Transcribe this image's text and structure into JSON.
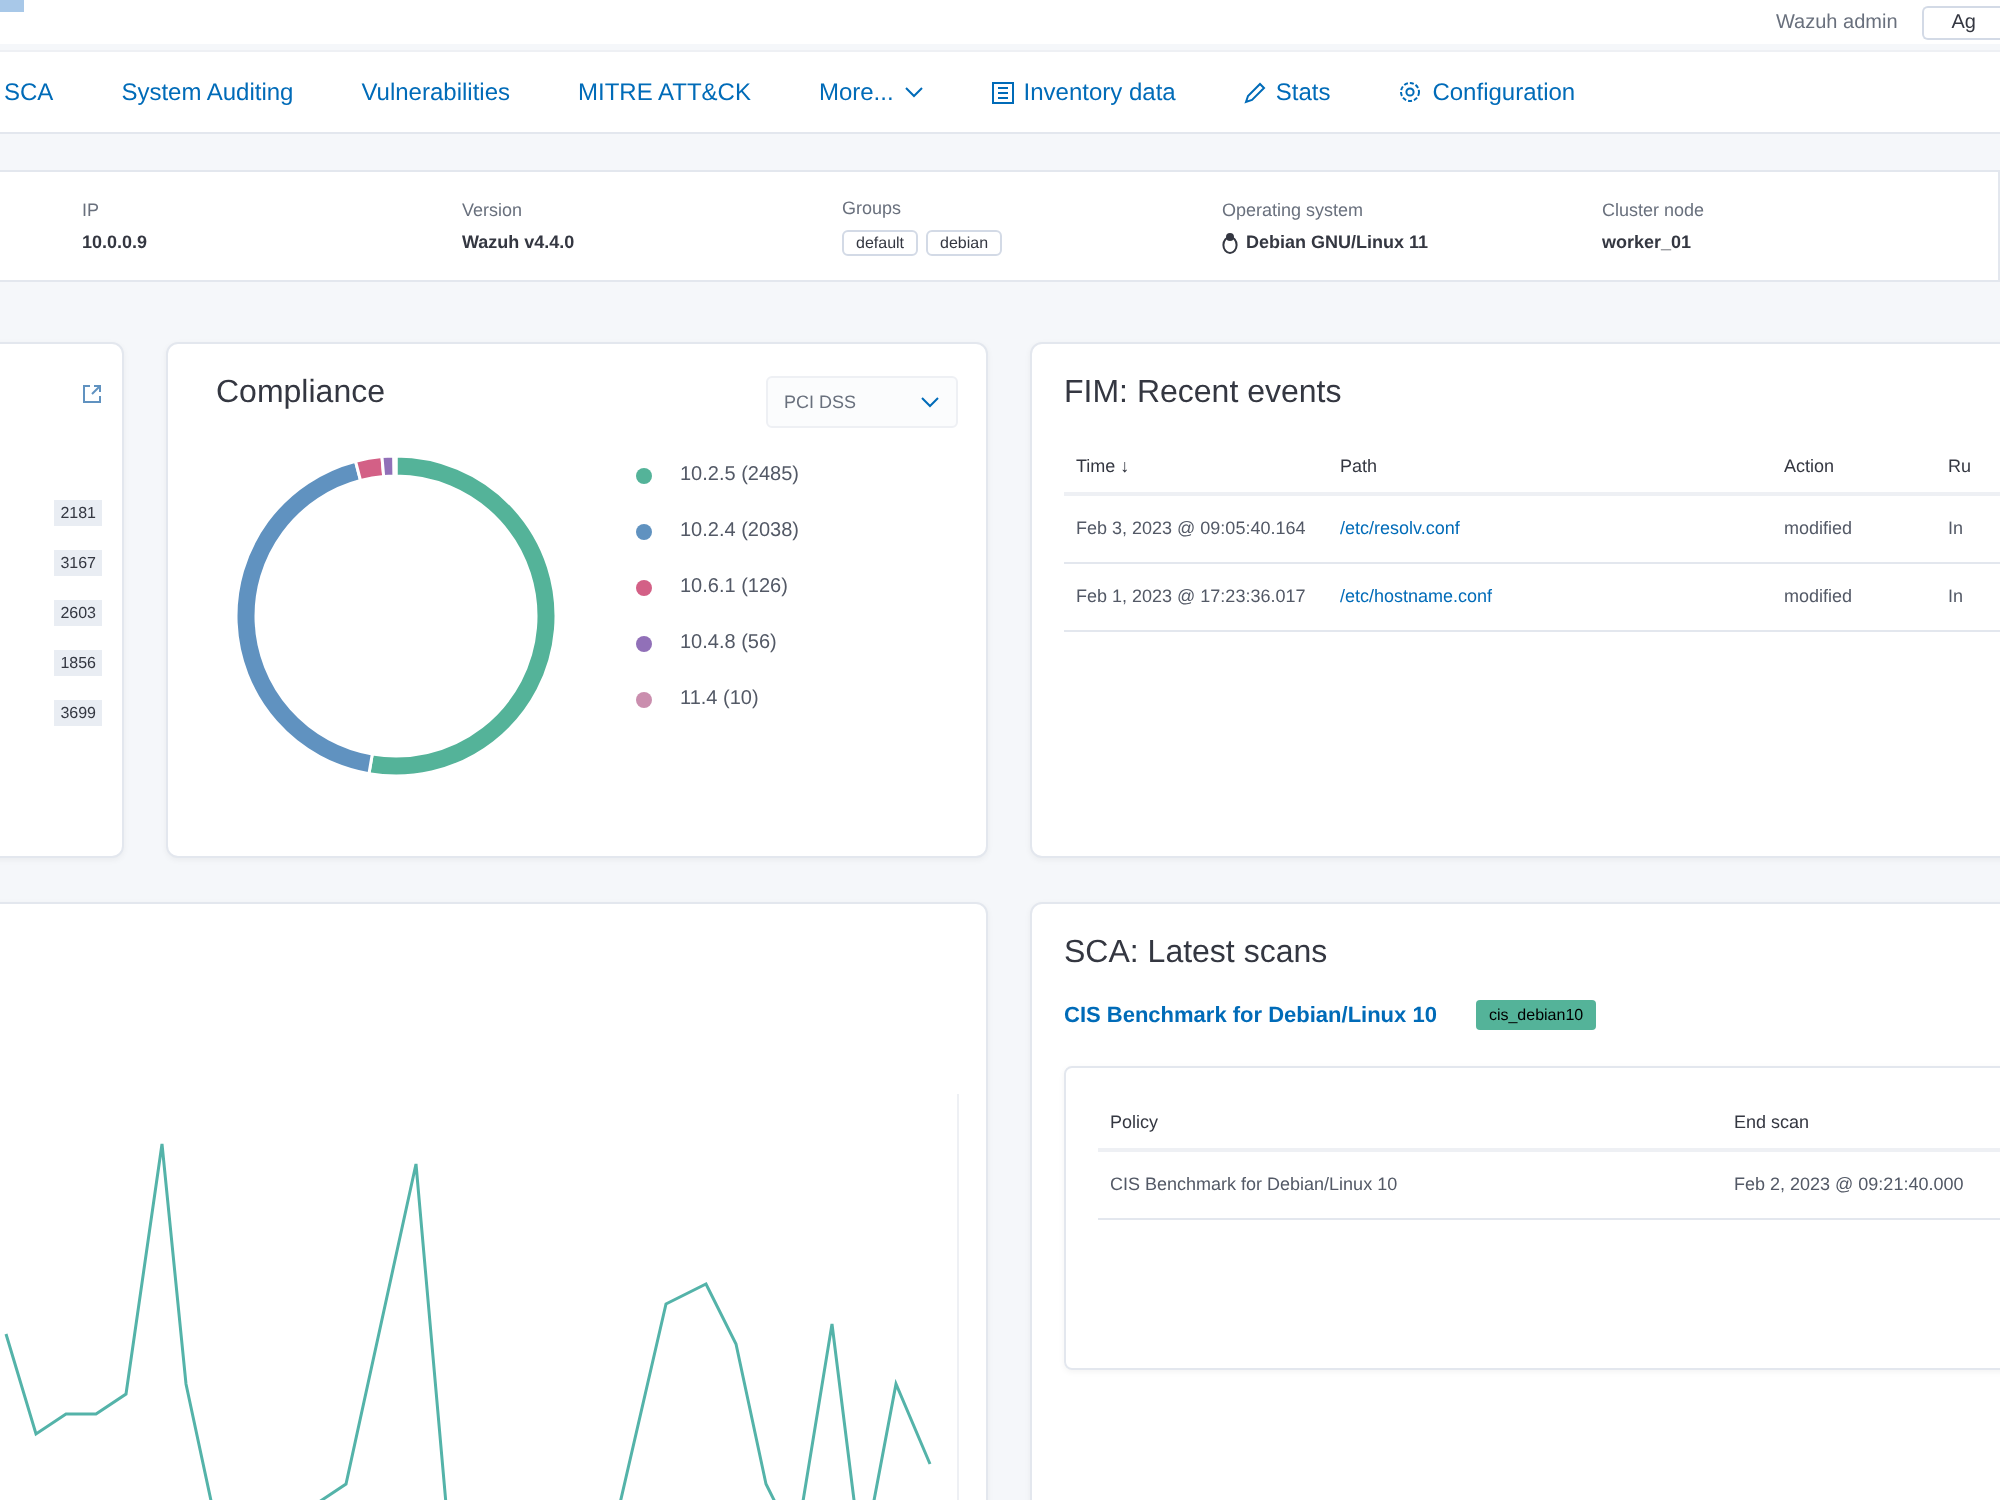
{
  "header": {
    "user": "Wazuh admin",
    "button": "Ag"
  },
  "tabs": [
    {
      "label": "SCA",
      "selected": false,
      "kind": "link"
    },
    {
      "label": "System Auditing",
      "selected": false,
      "kind": "link"
    },
    {
      "label": "Vulnerabilities",
      "selected": false,
      "kind": "link"
    },
    {
      "label": "MITRE ATT&CK",
      "selected": false,
      "kind": "link"
    },
    {
      "label": "More...",
      "selected": false,
      "kind": "menu"
    },
    {
      "label": "Inventory data",
      "selected": false,
      "kind": "action"
    },
    {
      "label": "Stats",
      "selected": false,
      "kind": "action"
    },
    {
      "label": "Configuration",
      "selected": false,
      "kind": "action"
    }
  ],
  "agent_info": [
    {
      "label": "IP",
      "value": "10.0.0.9"
    },
    {
      "label": "Version",
      "value": "Wazuh v4.4.0"
    },
    {
      "label": "Groups",
      "tags": [
        "default",
        "debian"
      ]
    },
    {
      "label": "Operating system",
      "value": "Debian GNU/Linux 11"
    },
    {
      "label": "Cluster node",
      "value": "worker_01"
    }
  ],
  "counts_card": {
    "badges": [
      "2181",
      "3167",
      "2603",
      "1856",
      "3699"
    ]
  },
  "compliance": {
    "title": "Compliance",
    "select": "PCI DSS",
    "chart_data": {
      "type": "donut",
      "categories": [
        "10.2.5 (2485)",
        "10.2.4 (2038)",
        "10.6.1 (126)",
        "10.4.8 (56)",
        "11.4 (10)"
      ],
      "values": [
        2485,
        2038,
        126,
        56,
        10
      ],
      "colors": [
        "#54b399",
        "#6092c0",
        "#d36086",
        "#9170b8",
        "#ca8eae"
      ]
    }
  },
  "fim": {
    "title": "FIM: Recent events",
    "columns": [
      "Time ↓",
      "Path",
      "Action",
      "Ru"
    ],
    "rows": [
      [
        "Feb 3, 2023 @ 09:05:40.164",
        "/etc/resolv.conf",
        "modified",
        "In"
      ],
      [
        "Feb 1, 2023 @ 17:23:36.017",
        "/etc/hostname.conf",
        "modified",
        "In"
      ]
    ]
  },
  "sca": {
    "title": "SCA: Latest scans",
    "policy_link": "CIS Benchmark for Debian/Linux 10",
    "badge": "cis_debian10",
    "columns": [
      "Policy",
      "End scan"
    ],
    "rows": [
      [
        "CIS Benchmark for Debian/Linux 10",
        "Feb 2, 2023 @ 09:21:40.000"
      ]
    ]
  }
}
